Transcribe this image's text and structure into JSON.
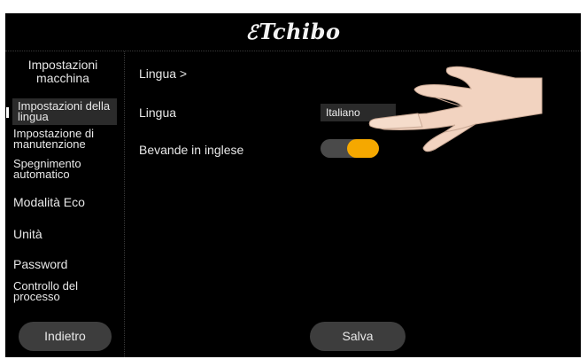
{
  "brand": {
    "logo_text": "Tchibo",
    "logo_mark": "ℰ"
  },
  "sidebar": {
    "title": "Impostazioni macchina",
    "items": [
      {
        "label": "Impostazioni della lingua",
        "active": true
      },
      {
        "label": "Impostazione di manutenzione"
      },
      {
        "label": "Spegnimento automatico"
      },
      {
        "label": "Modalità Eco"
      },
      {
        "label": "Unità"
      },
      {
        "label": "Password"
      },
      {
        "label": "Controllo del processo"
      }
    ],
    "back_label": "Indietro"
  },
  "main": {
    "breadcrumb": "Lingua >",
    "language_label": "Lingua",
    "language_value": "Italiano",
    "drinks_english_label": "Bevande in inglese",
    "drinks_english_on": true,
    "save_label": "Salva"
  },
  "colors": {
    "background": "#000000",
    "toggle_on": "#f5a800",
    "button_bg": "#3d3d3d"
  },
  "icons": {
    "hand": "pointing-hand-icon"
  }
}
